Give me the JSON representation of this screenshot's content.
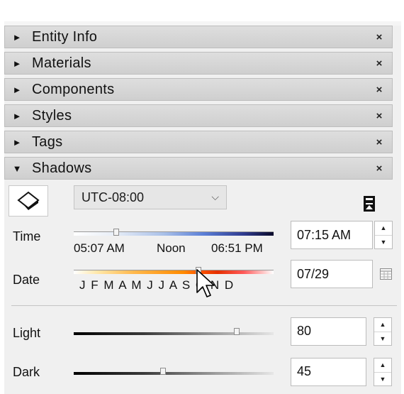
{
  "panels": [
    {
      "label": "Entity Info",
      "expanded": false
    },
    {
      "label": "Materials",
      "expanded": false
    },
    {
      "label": "Components",
      "expanded": false
    },
    {
      "label": "Styles",
      "expanded": false
    },
    {
      "label": "Tags",
      "expanded": false
    },
    {
      "label": "Shadows",
      "expanded": true
    }
  ],
  "glyphs": {
    "collapsed": "►",
    "expanded": "▼",
    "close": "×",
    "chevron": "⌵",
    "spin_up": "▲",
    "spin_down": "▼"
  },
  "shadows": {
    "timezone": "UTC-08:00",
    "time_label": "Time",
    "time_ticks": [
      "05:07 AM",
      "Noon",
      "06:51 PM"
    ],
    "time_value": "07:15 AM",
    "time_slider_fraction": 0.2,
    "date_label": "Date",
    "months": "J F M A M J J A S O N D",
    "date_value": "07/29",
    "date_slider_fraction": 0.6,
    "light_label": "Light",
    "light_value": "80",
    "dark_label": "Dark",
    "dark_value": "45",
    "icons": {
      "toggle": "shadow-toggle-icon",
      "dock": "dock-icon",
      "calendar": "calendar-icon",
      "cursor": "mouse-pointer"
    }
  }
}
